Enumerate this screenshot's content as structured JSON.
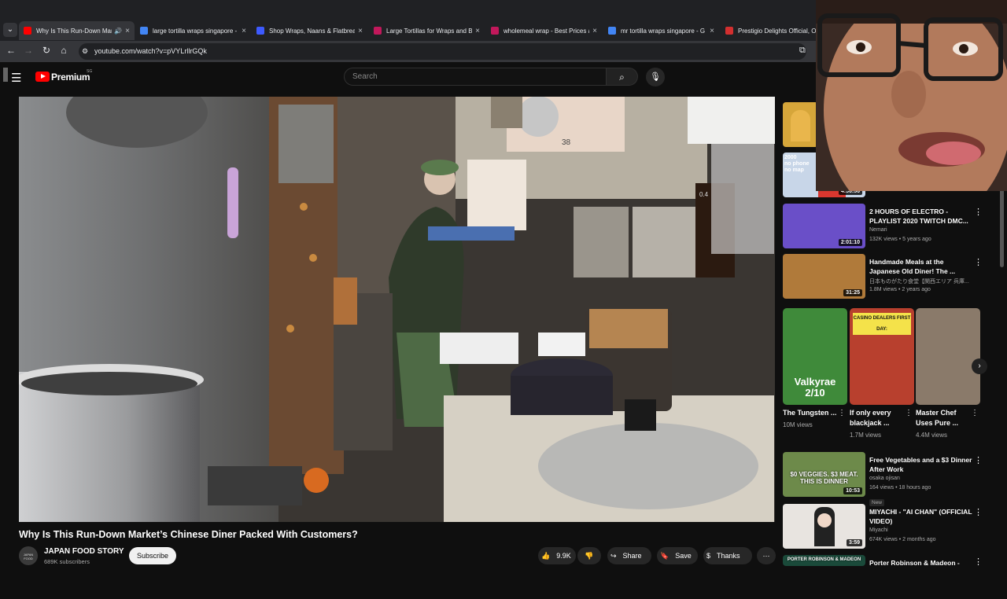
{
  "browser": {
    "tabs": [
      {
        "title": "Why Is This Run-Down Mar",
        "favicon": "youtube-icon",
        "color": "#ff0000"
      },
      {
        "title": "large tortilla wraps singapore -",
        "favicon": "google-icon",
        "color": "#4285f4"
      },
      {
        "title": "Shop Wraps, Naans & Flatbrea",
        "favicon": "shop-icon",
        "color": "#3d5afe"
      },
      {
        "title": "Large Tortillas for Wraps and Bu",
        "favicon": "store-icon",
        "color": "#c2185b"
      },
      {
        "title": "wholemeal wrap - Best Prices a",
        "favicon": "store-icon",
        "color": "#c2185b"
      },
      {
        "title": "mr tortilla wraps singapore - G",
        "favicon": "google-icon",
        "color": "#4285f4"
      },
      {
        "title": "Prestigio Delights Official, Onl",
        "favicon": "shop-icon",
        "color": "#d32f2f"
      }
    ],
    "url": "youtube.com/watch?v=pVYLrllrGQk"
  },
  "yt_header": {
    "brand": "Premium",
    "region": "SG",
    "search_placeholder": "Search"
  },
  "video": {
    "title": "Why Is This Run-Down Market’s Chinese Diner Packed With Customers?",
    "channel": "JAPAN FOOD STORY",
    "channel_avatar_text": "JAPAN FOOD",
    "subscribers": "689K subscribers",
    "subscribe_label": "Subscribe",
    "likes": "9.9K",
    "share_label": "Share",
    "save_label": "Save",
    "thanks_label": "Thanks",
    "overlay_labels": [
      "38",
      "0.4"
    ]
  },
  "sidebar": {
    "top_durations": [
      "4:56:56"
    ],
    "top_thumb_texts": [
      "2000",
      "no phone",
      "no map"
    ],
    "recommendations": [
      {
        "title": "2 HOURS OF ELECTRO - PLAYLIST 2020 TWITCH DMC...",
        "channel": "Nemari",
        "meta": "132K views • 5 years ago",
        "duration": "2:01:10",
        "thumb": "#6a4fc8"
      },
      {
        "title": "Handmade Meals at the Japanese Old Diner! The ...",
        "channel": "日本ものがたり食堂【関西エリア 兵庫...",
        "meta": "1.8M views • 2 years ago",
        "duration": "31:25",
        "thumb": "#b07a3a"
      }
    ],
    "shorts": [
      {
        "title": "The Tungsten ...",
        "views": "10M views",
        "overlay": "Valkyrae 2/10"
      },
      {
        "title": "If only every blackjack ...",
        "views": "1.7M views",
        "overlay": "CASINO DEALERS FIRST DAY:"
      },
      {
        "title": "Master Chef Uses Pure ...",
        "views": "4.4M views",
        "overlay": ""
      }
    ],
    "recommendations2": [
      {
        "title": "Free Vegetables and a $3 Dinner After Work",
        "channel": "osaka ojisan",
        "meta": "164 views • 18 hours ago",
        "badge": "New",
        "duration": "10:53",
        "thumb_text": "$0 VEGGIES. $3 MEAT. THIS IS DINNER"
      },
      {
        "title": "MIYACHI - \"AI CHAN\" (OFFICIAL VIDEO)",
        "channel": "Miyachi",
        "meta": "674K views • 2 months ago",
        "duration": "3:59"
      },
      {
        "title": "Porter Robinson & Madeon -",
        "thumb_text": "PORTER ROBINSON & MADEON"
      }
    ]
  }
}
